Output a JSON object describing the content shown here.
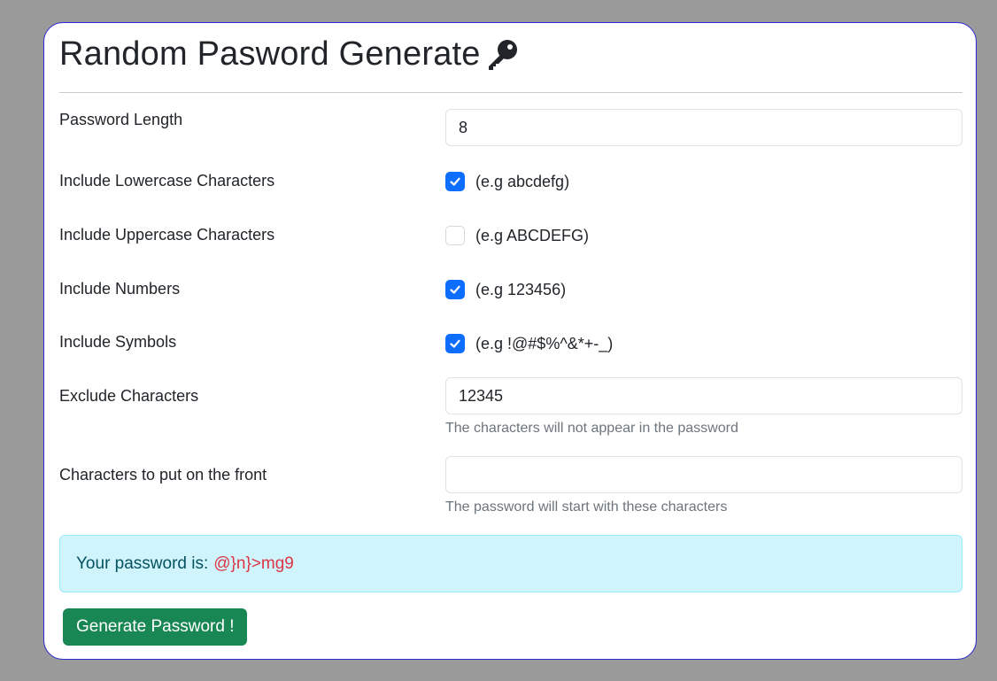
{
  "header": {
    "title": "Random Pasword Generate",
    "icon": "key-icon"
  },
  "form": {
    "length": {
      "label": "Password Length",
      "value": "8"
    },
    "lowercase": {
      "label": "Include Lowercase Characters",
      "example": "(e.g abcdefg)",
      "checked": true
    },
    "uppercase": {
      "label": "Include Uppercase Characters",
      "example": "(e.g ABCDEFG)",
      "checked": false
    },
    "numbers": {
      "label": "Include Numbers",
      "example": "(e.g 123456)",
      "checked": true
    },
    "symbols": {
      "label": "Include Symbols",
      "example": "(e.g !@#$%^&*+-_)",
      "checked": true
    },
    "exclude": {
      "label": "Exclude Characters",
      "value": "12345",
      "help": "The characters will not appear in the password"
    },
    "prefix": {
      "label": "Characters to put on the front",
      "value": "",
      "help": "The password will start with these characters"
    }
  },
  "result": {
    "prefix_text": "Your password is:",
    "password": "@}n}>mg9"
  },
  "actions": {
    "generate_label": "Generate Password !"
  },
  "colors": {
    "accent": "#0d6efd",
    "button": "#198754",
    "alert_bg": "#cff4fc",
    "password_text": "#dc3545"
  }
}
